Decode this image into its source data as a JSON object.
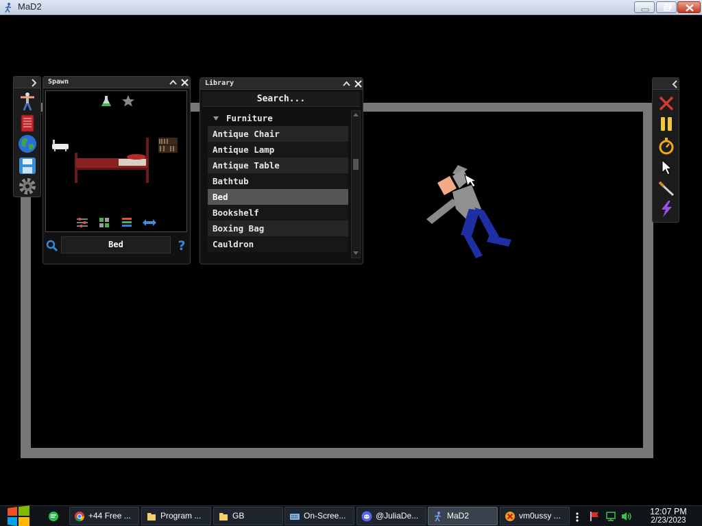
{
  "window": {
    "title": "MaD2"
  },
  "spawn_panel": {
    "title": "Spawn",
    "selected_item": "Bed"
  },
  "library_panel": {
    "title": "Library",
    "search_placeholder": "Search...",
    "category": "Furniture",
    "items": [
      "Antique Chair",
      "Antique Lamp",
      "Antique Table",
      "Bathtub",
      "Bed",
      "Bookshelf",
      "Boxing Bag",
      "Cauldron"
    ],
    "selected_index": 4
  },
  "left_toolbar": {
    "icons": [
      "ragdoll-icon",
      "book-icon",
      "globe-icon",
      "save-icon",
      "settings-gear-icon"
    ]
  },
  "right_toolbar": {
    "icons": [
      "close-x-icon",
      "pause-icon",
      "stopwatch-icon",
      "pointer-cursor-icon",
      "knife-icon",
      "lightning-icon"
    ]
  },
  "taskbar": {
    "tasks": [
      {
        "label": "+44 Free ...",
        "icon": "chrome-icon"
      },
      {
        "label": "Program ...",
        "icon": "folder-icon"
      },
      {
        "label": "GB",
        "icon": "folder-icon"
      },
      {
        "label": "On-Scree...",
        "icon": "keyboard-icon"
      },
      {
        "label": "@JuliaDe...",
        "icon": "discord-icon"
      },
      {
        "label": "MaD2",
        "icon": "mad2-icon"
      },
      {
        "label": "vm0ussy ...",
        "icon": "app-icon"
      }
    ],
    "active_task": "MaD2",
    "clock_time": "12:07 PM",
    "clock_date": "2/23/2023"
  },
  "colors": {
    "arena_border": "#777777",
    "background": "#000000",
    "selected_row": "#555555"
  }
}
